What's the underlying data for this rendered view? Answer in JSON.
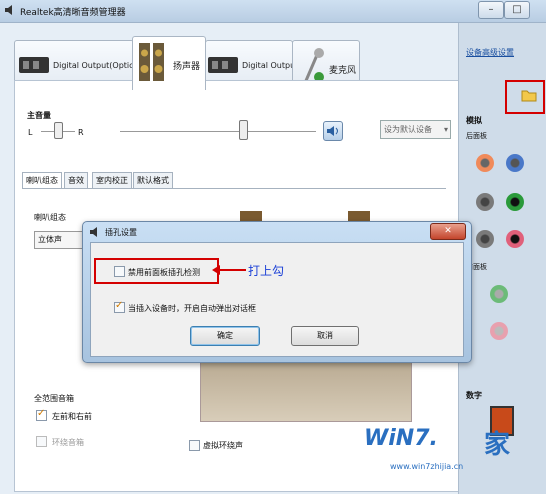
{
  "window": {
    "title": "Realtek高清晰音频管理器",
    "controls": [
      "–",
      "□",
      "✕"
    ]
  },
  "device_tabs": [
    {
      "label": "Digital Output(Optical)",
      "active": false
    },
    {
      "label": "扬声器",
      "active": true
    },
    {
      "label": "Digital Output",
      "active": false
    },
    {
      "label": "麦克风",
      "active": false
    }
  ],
  "volume": {
    "section_label": "主音量",
    "left": "L",
    "right": "R",
    "default_device_button": "设为默认设备"
  },
  "sub_tabs": [
    "喇叭组态",
    "音效",
    "室内校正",
    "默认格式"
  ],
  "speaker_config": {
    "label": "喇叭组态",
    "selected": "立体声"
  },
  "surround": {
    "group_label": "全范围音箱",
    "front_lr": {
      "label": "左前和右前",
      "checked": true
    },
    "surround_speakers": {
      "label": "环绕音箱",
      "checked": false,
      "enabled": false
    },
    "virtual_surround": {
      "label": "虚拟环绕声",
      "checked": false
    }
  },
  "right_panel": {
    "advanced_link": "设备高级设置",
    "analog_label": "模拟",
    "rear_panel_label": "后面板",
    "front_panel_label": "前面板",
    "digital_label": "数字"
  },
  "dialog": {
    "title": "插孔设置",
    "option1": {
      "label": "禁用前面板插孔检测",
      "checked": false
    },
    "option2": {
      "label": "当插入设备时，开启自动弹出对话框",
      "checked": true
    },
    "ok_button": "确定",
    "cancel_button": "取消",
    "close": "✕"
  },
  "annotation": {
    "text": "打上勾",
    "color": "#1a3fd6"
  },
  "watermark": {
    "brand": "WiN7.",
    "brand2": "家",
    "url": "www.win7zhijia.cn"
  },
  "colors": {
    "annotation_red": "#d40000",
    "jack_orange": "#f08a5a",
    "jack_blue": "#4a78c8",
    "jack_gray": "#7a7a7a",
    "jack_green": "#2a9a3a",
    "jack_pink": "#e0607a"
  }
}
